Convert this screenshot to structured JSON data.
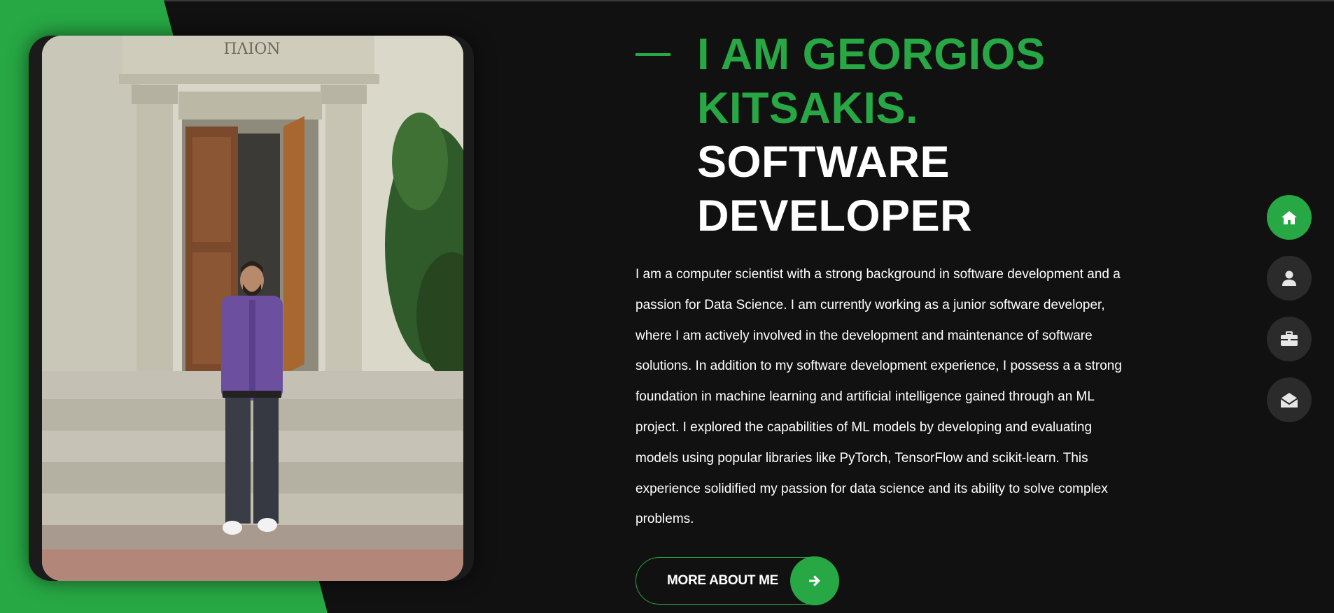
{
  "hero": {
    "name_line": "I AM GEORGIOS KITSAKIS.",
    "role_line": "SOFTWARE DEVELOPER",
    "bio": "I am a computer scientist with a strong background in software development and a passion for Data Science. I am currently working as a junior software developer, where I am actively involved in the development and maintenance of software solutions. In addition to my software development experience, I possess a a strong foundation in machine learning and artificial intelligence gained through an ML project. I explored the capabilities of ML models by developing and evaluating models using popular libraries like PyTorch, TensorFlow and scikit-learn. This experience solidified my passion for data science and its ability to solve complex problems.",
    "cta_label": "MORE ABOUT ME",
    "cta_icon": "arrow-right-icon"
  },
  "photo": {
    "subject": "profile-photo",
    "building_inscription": "ΠΛΙΟΝ"
  },
  "side_nav": {
    "items": [
      {
        "icon": "home-icon",
        "active": true
      },
      {
        "icon": "user-icon",
        "active": false
      },
      {
        "icon": "briefcase-icon",
        "active": false
      },
      {
        "icon": "envelope-open-icon",
        "active": false
      }
    ]
  },
  "colors": {
    "accent": "#27a844",
    "background": "#111111",
    "nav_inactive": "#2b2b2b",
    "text": "#ffffff"
  }
}
